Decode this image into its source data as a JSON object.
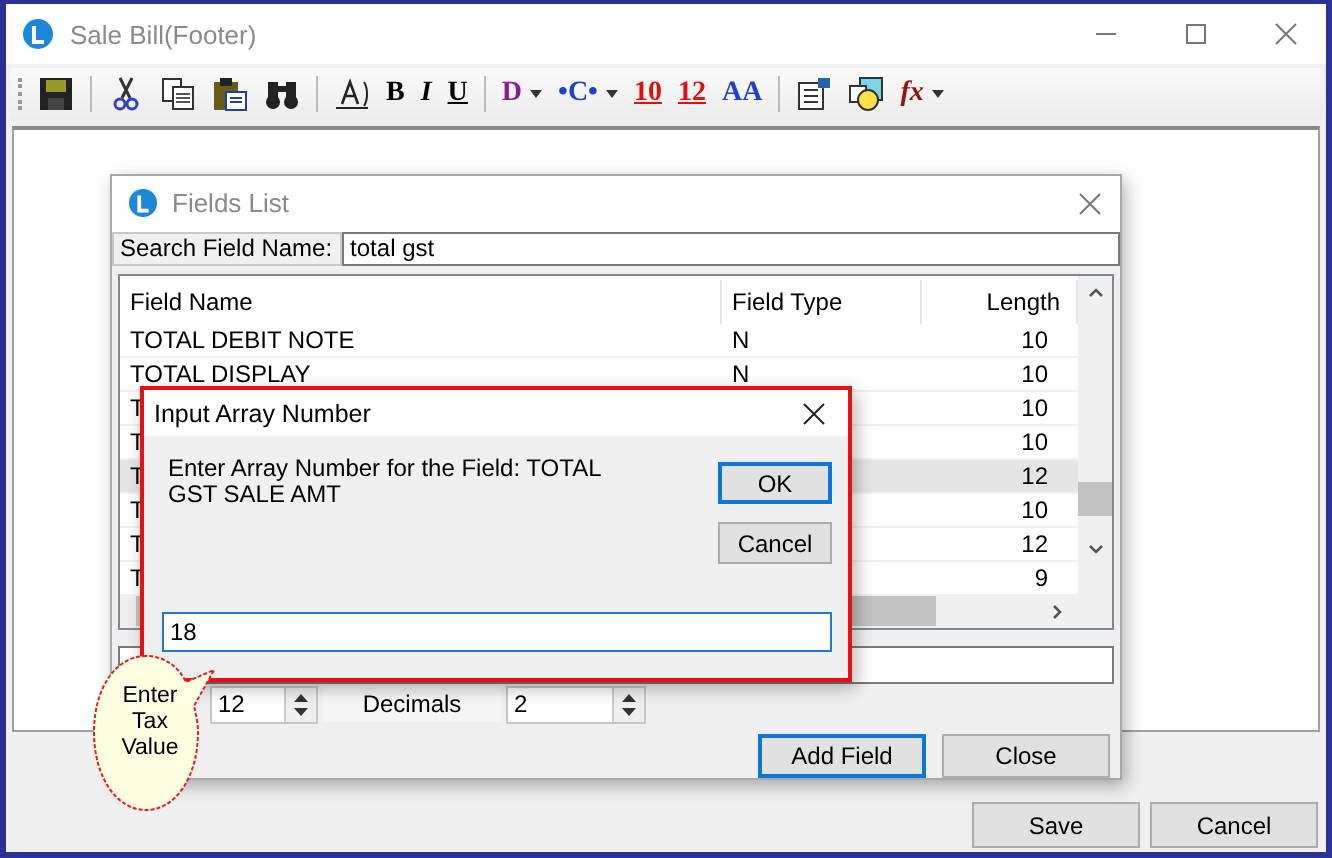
{
  "window": {
    "title": "Sale Bill(Footer)"
  },
  "toolbar": [
    {
      "kind": "save"
    },
    {
      "kind": "separator"
    },
    {
      "kind": "cut"
    },
    {
      "kind": "copy"
    },
    {
      "kind": "paste"
    },
    {
      "kind": "find"
    },
    {
      "kind": "separator"
    },
    {
      "kind": "textbox"
    },
    {
      "kind": "glyph",
      "label": "B"
    },
    {
      "kind": "glyph",
      "label": "I"
    },
    {
      "kind": "glyph",
      "label": "U"
    },
    {
      "kind": "separator"
    },
    {
      "kind": "menu",
      "label": "D"
    },
    {
      "kind": "menu",
      "label": "•C•"
    },
    {
      "kind": "glyph",
      "label": "10"
    },
    {
      "kind": "glyph",
      "label": "12"
    },
    {
      "kind": "glyph",
      "label": "AA"
    },
    {
      "kind": "separator"
    },
    {
      "kind": "props"
    },
    {
      "kind": "shapes"
    },
    {
      "kind": "menu",
      "label": "fx"
    }
  ],
  "fields_list": {
    "title": "Fields List",
    "search": {
      "label": "Search Field Name:",
      "value": "total gst"
    },
    "columns": [
      "Field Name",
      "Field Type",
      "Length"
    ],
    "rows": [
      {
        "name": "TOTAL DEBIT NOTE",
        "type": "N",
        "length": "10",
        "selected": false
      },
      {
        "name": "TOTAL DISPLAY",
        "type": "N",
        "length": "10",
        "selected": false
      },
      {
        "name": "T",
        "length": "10",
        "selected": false
      },
      {
        "name": "T",
        "length": "10",
        "selected": false
      },
      {
        "name": "T",
        "length": "12",
        "selected": true
      },
      {
        "name": "T",
        "length": "10",
        "selected": false
      },
      {
        "name": "T",
        "length": "12",
        "selected": false
      },
      {
        "name": "T",
        "length": "9",
        "selected": false
      }
    ],
    "length_value": "12",
    "decimals_label": "Decimals",
    "decimals_value": "2",
    "buttons": [
      "Add Field",
      "Close"
    ]
  },
  "input_dialog": {
    "title": "Input Array Number",
    "message": "Enter Array Number for the Field: TOTAL GST SALE AMT",
    "value": "18",
    "buttons": [
      "OK",
      "Cancel"
    ]
  },
  "callout": {
    "text": "Enter Tax Value"
  },
  "footer_buttons": [
    "Save",
    "Cancel"
  ]
}
